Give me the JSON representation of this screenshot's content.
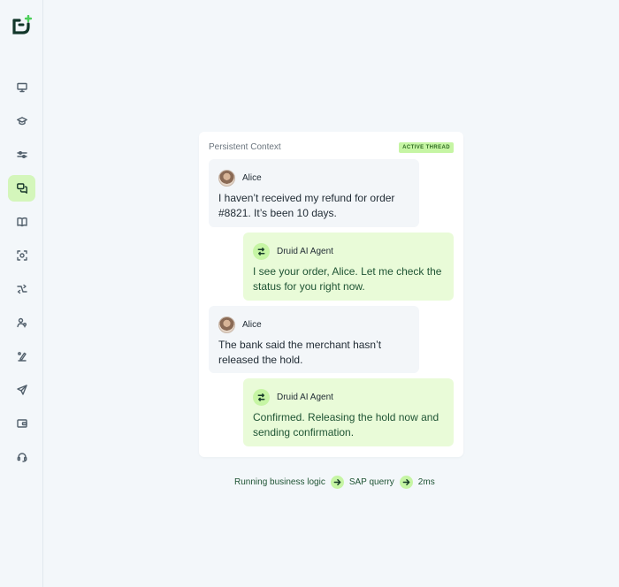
{
  "sidebar": {
    "logo": "druid-logo",
    "items": [
      {
        "icon": "presentation-icon"
      },
      {
        "icon": "graduation-cap-icon"
      },
      {
        "icon": "sliders-icon"
      },
      {
        "icon": "chat-bubbles-icon",
        "active": true
      },
      {
        "icon": "book-icon"
      },
      {
        "icon": "scan-icon"
      },
      {
        "icon": "workflow-icon"
      },
      {
        "icon": "user-location-icon"
      },
      {
        "icon": "draw-tool-icon"
      },
      {
        "icon": "send-icon"
      },
      {
        "icon": "wallet-icon"
      },
      {
        "icon": "headset-icon"
      }
    ]
  },
  "card": {
    "title": "Persistent Context",
    "badge": "ACTIVE THREAD"
  },
  "messages": [
    {
      "role": "user",
      "name": "Alice",
      "text": "I haven’t received my refund for order #8821. It’s been 10 days."
    },
    {
      "role": "agent",
      "name": "Druid AI Agent",
      "text": "I see your order, Alice. Let me check the status for you right now."
    },
    {
      "role": "user",
      "name": "Alice",
      "text": "The bank said the merchant hasn’t released the hold."
    },
    {
      "role": "agent",
      "name": "Druid AI Agent",
      "text": "Confirmed. Releasing the hold now and sending confirmation."
    }
  ],
  "pipeline": {
    "step1": "Running business logic",
    "step2": "SAP querry",
    "step3": "2ms"
  },
  "colors": {
    "accent": "#c6f5a4",
    "active_nav": "#d4f6bb",
    "agent_bubble": "#e9fbd8",
    "user_bubble": "#f3f6f9",
    "background": "#f3f7fa"
  }
}
